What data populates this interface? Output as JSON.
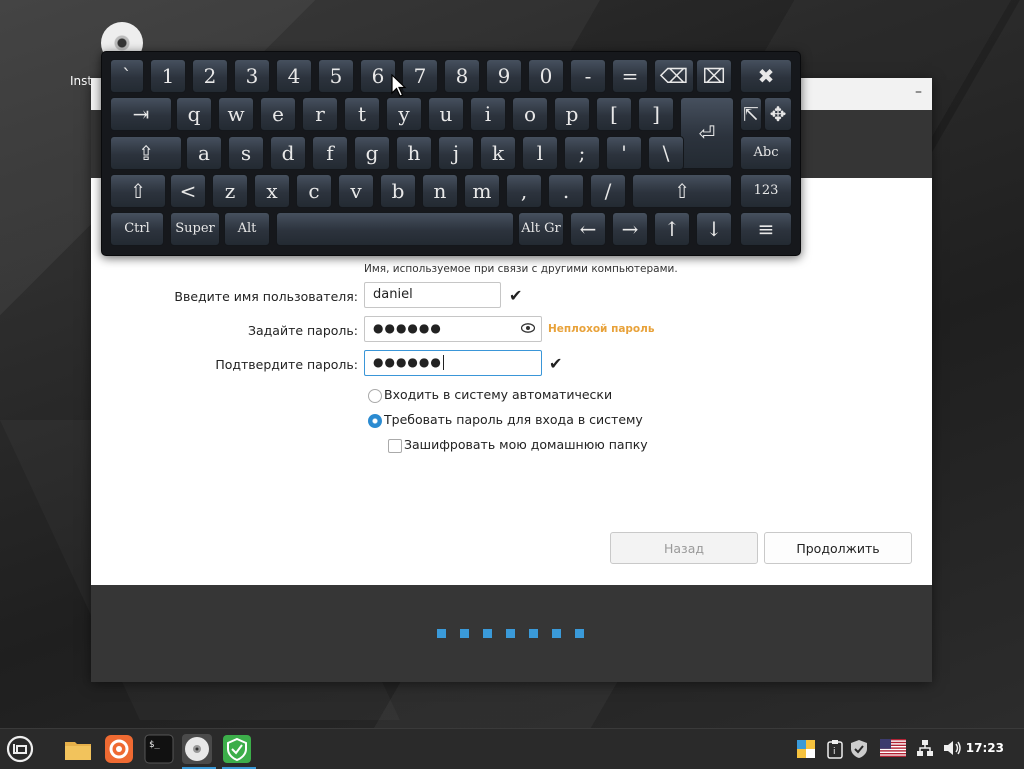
{
  "desktop": {
    "icon_label": "Inst"
  },
  "installer": {
    "hostname_hint": "Имя, используемое при связи с другими компьютерами.",
    "username_label": "Введите имя пользователя:",
    "username_value": "daniel",
    "password_label": "Задайте пароль:",
    "password_value": "●●●●●●",
    "password_strength": "Неплохой пароль",
    "confirm_label": "Подтвердите пароль:",
    "confirm_value": "●●●●●●",
    "login_auto_label": "Входить в систему автоматически",
    "login_require_label": "Требовать пароль для входа в систему",
    "encrypt_home_label": "Зашифровать мою домашнюю папку",
    "login_option_selected": "Требовать пароль для входа в систему",
    "encrypt_home_checked": false,
    "back_button": "Назад",
    "continue_button": "Продолжить",
    "progress_steps": 7
  },
  "keyboard": {
    "row1": [
      "`",
      "1",
      "2",
      "3",
      "4",
      "5",
      "6",
      "7",
      "8",
      "9",
      "0",
      "-",
      "=",
      "⌫",
      "⌧",
      "✖"
    ],
    "row2": [
      "⇥",
      "q",
      "w",
      "e",
      "r",
      "t",
      "y",
      "u",
      "i",
      "o",
      "p",
      "[",
      "]",
      "⏎",
      "⇱",
      "✥"
    ],
    "row3": [
      "⇪",
      "a",
      "s",
      "d",
      "f",
      "g",
      "h",
      "j",
      "k",
      "l",
      ";",
      "'",
      "\\",
      "Abc"
    ],
    "row4": [
      "⇧",
      "<",
      "z",
      "x",
      "c",
      "v",
      "b",
      "n",
      "m",
      ",",
      ".",
      "/",
      "⇧",
      "123"
    ],
    "row5": [
      "Ctrl",
      "Super",
      "Alt",
      "",
      "Alt Gr",
      "←",
      "→",
      "↑",
      "↓",
      "≡"
    ]
  },
  "taskbar": {
    "clock": "17:23",
    "apps": [
      "menu-icon",
      "files-icon",
      "firefox-icon",
      "terminal-icon",
      "installer-disc-icon",
      "shield-update-icon"
    ],
    "tray": [
      "color-icon",
      "clipboard-icon",
      "shield-icon",
      "us-flag-icon",
      "network-icon",
      "volume-icon"
    ]
  },
  "colors": {
    "accent": "#3a9ad9",
    "strength": "#e8a23a",
    "header": "#353535"
  }
}
